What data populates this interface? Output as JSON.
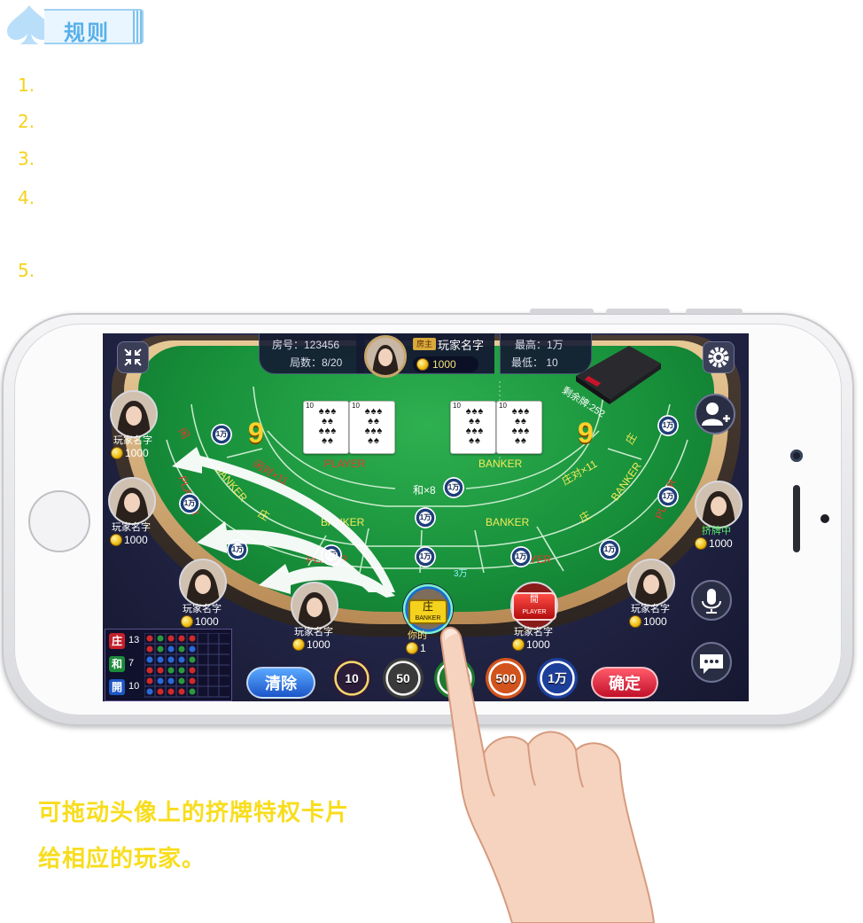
{
  "rules": {
    "title": "规则",
    "items": [
      "1.",
      "2.",
      "3.",
      "4.",
      "5."
    ]
  },
  "room": {
    "room_no": "房号：123456",
    "round": "局数：8/20",
    "max": "最高：1万",
    "min": "最低：  10"
  },
  "host": {
    "badge": "房主",
    "name": "玩家名字",
    "coins": "1000"
  },
  "shoe": {
    "label": "剩余牌:252"
  },
  "table": {
    "player_score": "9",
    "banker_score": "9",
    "player_label": "PLAYER",
    "banker_label": "BANKER",
    "banker_lane": "BANKER",
    "banker_mid": "BANKER",
    "player_lane": "PLAYER",
    "player_lane2": "PLAYER",
    "tie_label": "和×8",
    "banker_pair": "庄对×11",
    "player_pair": "闲对×11",
    "left_zhuang": "庄",
    "left_xian": "闲",
    "right_zhuang": "庄",
    "right_zhuang2": "庄",
    "left_banker_side": "BANKER",
    "right_banker_side": "BANKER",
    "right_player_side": "PLAYER",
    "left_player_side": "PLAYER",
    "total_bet": "3万",
    "card_ranks": [
      "10",
      "10",
      "10",
      "10"
    ]
  },
  "chips_on_table": [
    "1万",
    "1万",
    "1万",
    "1万",
    "1万",
    "1万",
    "1万",
    "1万",
    "1万",
    "1万",
    "1万",
    "1万"
  ],
  "seats": [
    {
      "name": "玩家名字",
      "coins": "1000"
    },
    {
      "name": "玩家名字",
      "coins": "1000"
    },
    {
      "name": "玩家名字",
      "coins": "1000"
    },
    {
      "name": "玩家名字",
      "coins": "1000"
    },
    {
      "name": "你的",
      "coins": "1"
    },
    {
      "name": "玩家名字",
      "coins": "1000"
    },
    {
      "name": "玩家名字",
      "coins": "1000"
    },
    {
      "status": "挤牌中",
      "coins": "1000"
    }
  ],
  "dealer_card": {
    "top": "庄",
    "bottom": "BANKER"
  },
  "player_card": {
    "top": "閒",
    "bottom": "PLAYER"
  },
  "history": {
    "banker_label": "庄",
    "banker_count": "13",
    "tie_label": "和",
    "tie_count": "7",
    "player_label": "開",
    "player_count": "10"
  },
  "bet_controls": {
    "clear": "清除",
    "confirm": "确定",
    "chips": [
      "10",
      "50",
      "",
      "500",
      "1万"
    ]
  },
  "caption": {
    "line1": "可拖动头像上的挤牌特权卡片",
    "line2": "给相应的玩家。"
  },
  "colors": {
    "rule_number": "#f5d21a",
    "caption": "#f8dd1d",
    "felt": "#18913b",
    "title_blue": "#58b0ea"
  },
  "icons": [
    "spade-icon",
    "collapse-icon",
    "settings-gear-icon",
    "add-friend-icon",
    "microphone-icon",
    "chat-bubble-icon"
  ]
}
